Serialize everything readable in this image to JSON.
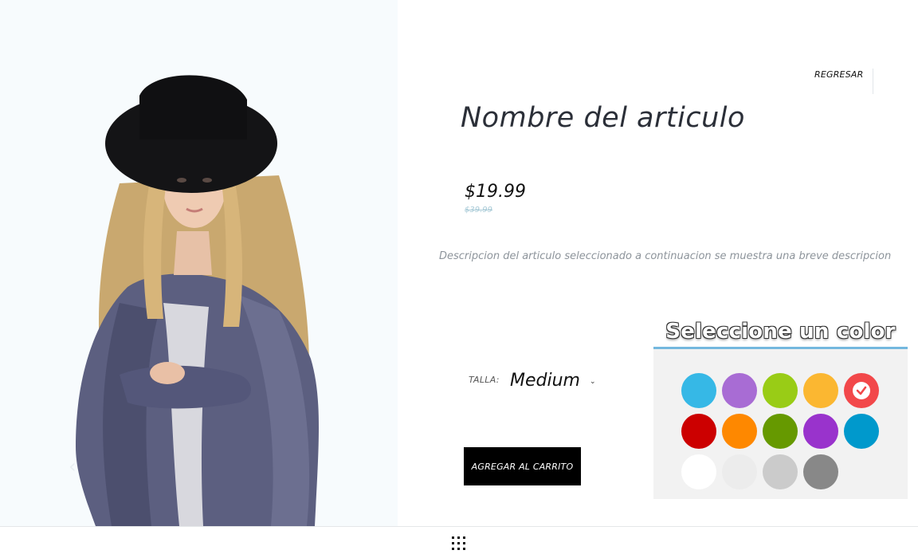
{
  "navigation": {
    "back_label": "REGRESAR"
  },
  "product": {
    "name": "Nombre del articulo",
    "price": "$19.99",
    "old_price": "$39.99",
    "description": "Descripcion del articulo seleccionado a continuacion se muestra una breve descripcion"
  },
  "size": {
    "label": "TALLA:",
    "selected": "Medium"
  },
  "cart": {
    "button_label": "AGREGAR AL CARRITO"
  },
  "color_picker": {
    "title": "Seleccione un color",
    "selected_index": 4,
    "swatches": [
      "#36b8e6",
      "#a86cd4",
      "#99cc16",
      "#fbb731",
      "#f2484a",
      "#cc0000",
      "#fe8800",
      "#669900",
      "#9933cc",
      "#0099cc",
      "#ffffff",
      "#ececec",
      "#cbcbcb",
      "#888888"
    ]
  },
  "icons": {
    "prev": "chevron-left-icon",
    "apps": "grid-icon",
    "selected": "checkmark-icon"
  }
}
